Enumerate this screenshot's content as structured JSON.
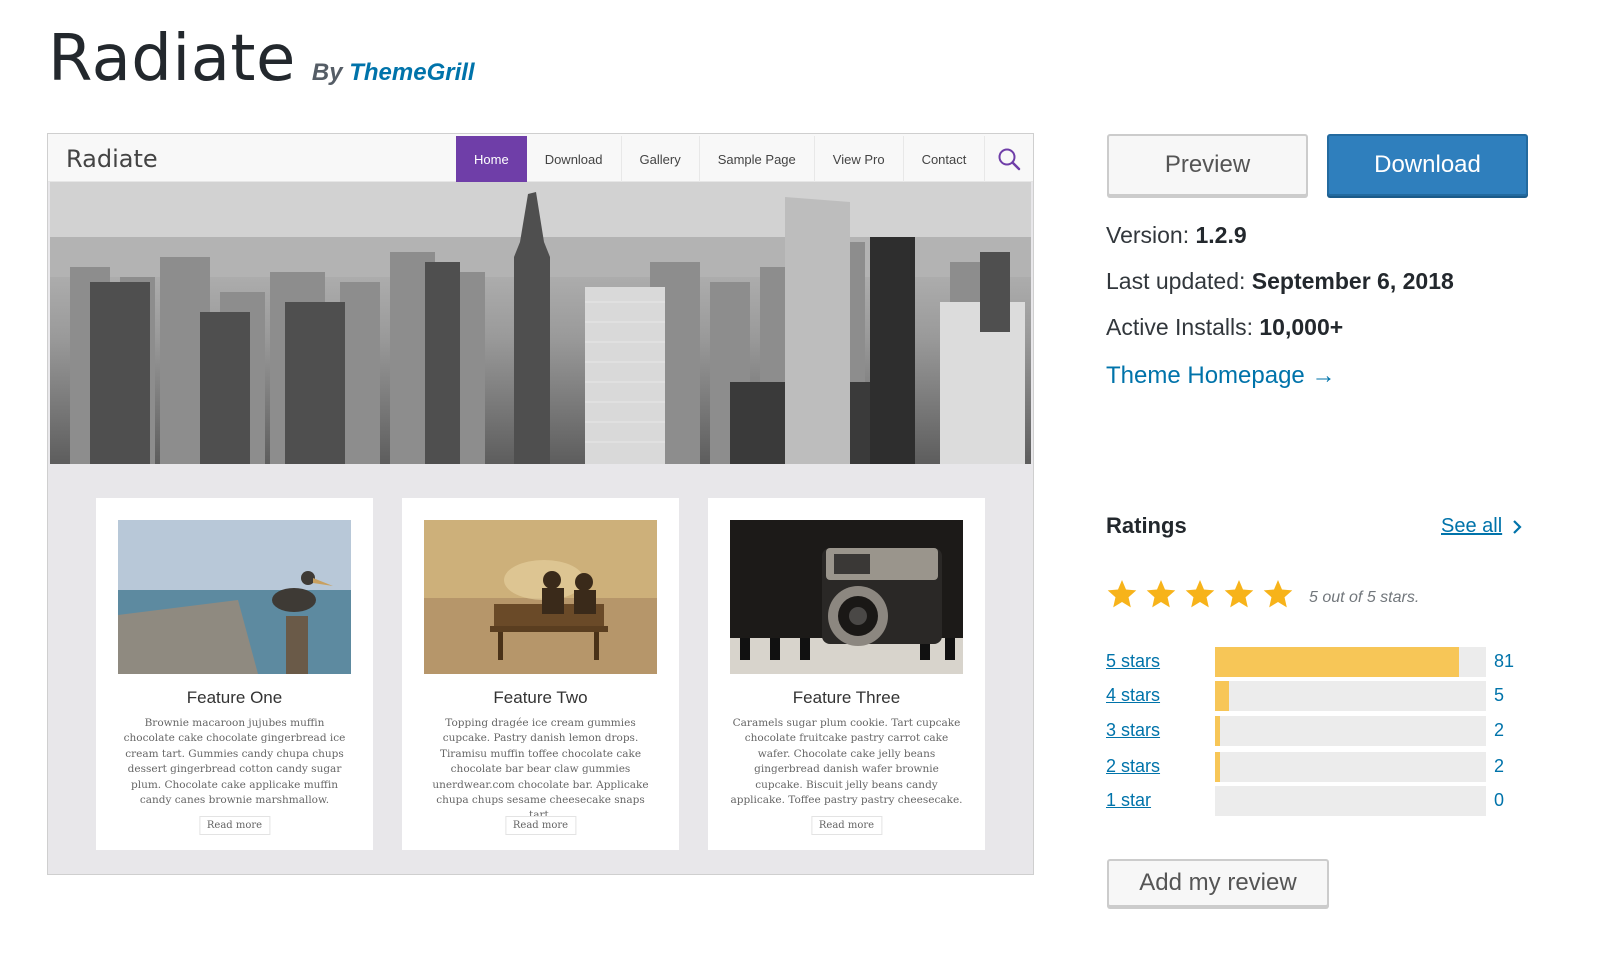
{
  "theme": {
    "title": "Radiate",
    "by_prefix": "By",
    "author": "ThemeGrill"
  },
  "screenshot": {
    "logo": "Radiate",
    "menu": [
      "Home",
      "Download",
      "Gallery",
      "Sample Page",
      "View Pro",
      "Contact"
    ],
    "active_menu": "Home",
    "accent_color": "#6f3ea8",
    "features": [
      {
        "title": "Feature One",
        "text": "Brownie macaroon jujubes muffin chocolate cake chocolate gingerbread ice cream tart. Gummies candy chupa chups dessert gingerbread cotton candy sugar plum. Chocolate cake applicake muffin candy canes brownie marshmallow.",
        "button": "Read more",
        "image": "pelican-on-pier"
      },
      {
        "title": "Feature Two",
        "text": "Topping dragée ice cream gummies cupcake. Pastry danish lemon drops. Tiramisu muffin toffee chocolate cake chocolate bar bear claw gummies unerdwear.com chocolate bar. Applicake chupa chups sesame cheesecake snaps tart.",
        "button": "Read more",
        "image": "couple-on-bench"
      },
      {
        "title": "Feature Three",
        "text": "Caramels sugar plum cookie. Tart cupcake chocolate fruitcake pastry carrot cake wafer. Chocolate cake jelly beans gingerbread danish wafer brownie cupcake. Biscuit jelly beans candy applicake. Toffee pastry pastry cheesecake.",
        "button": "Read more",
        "image": "vintage-camera"
      }
    ]
  },
  "actions": {
    "preview": "Preview",
    "download": "Download"
  },
  "meta": {
    "version_label": "Version:",
    "version": "1.2.9",
    "updated_label": "Last updated:",
    "updated": "September 6, 2018",
    "installs_label": "Active Installs:",
    "installs": "10,000+",
    "homepage": "Theme Homepage →"
  },
  "ratings": {
    "title": "Ratings",
    "see_all": "See all",
    "average_text": "5 out of 5 stars.",
    "star_color": "#f7b31a",
    "rows": [
      {
        "label": "5 stars",
        "count": "81",
        "fraction": 0.9
      },
      {
        "label": "4 stars",
        "count": "5",
        "fraction": 0.05
      },
      {
        "label": "3 stars",
        "count": "2",
        "fraction": 0.02
      },
      {
        "label": "2 stars",
        "count": "2",
        "fraction": 0.02
      },
      {
        "label": "1 star",
        "count": "0",
        "fraction": 0.0
      }
    ],
    "add_review": "Add my review"
  }
}
